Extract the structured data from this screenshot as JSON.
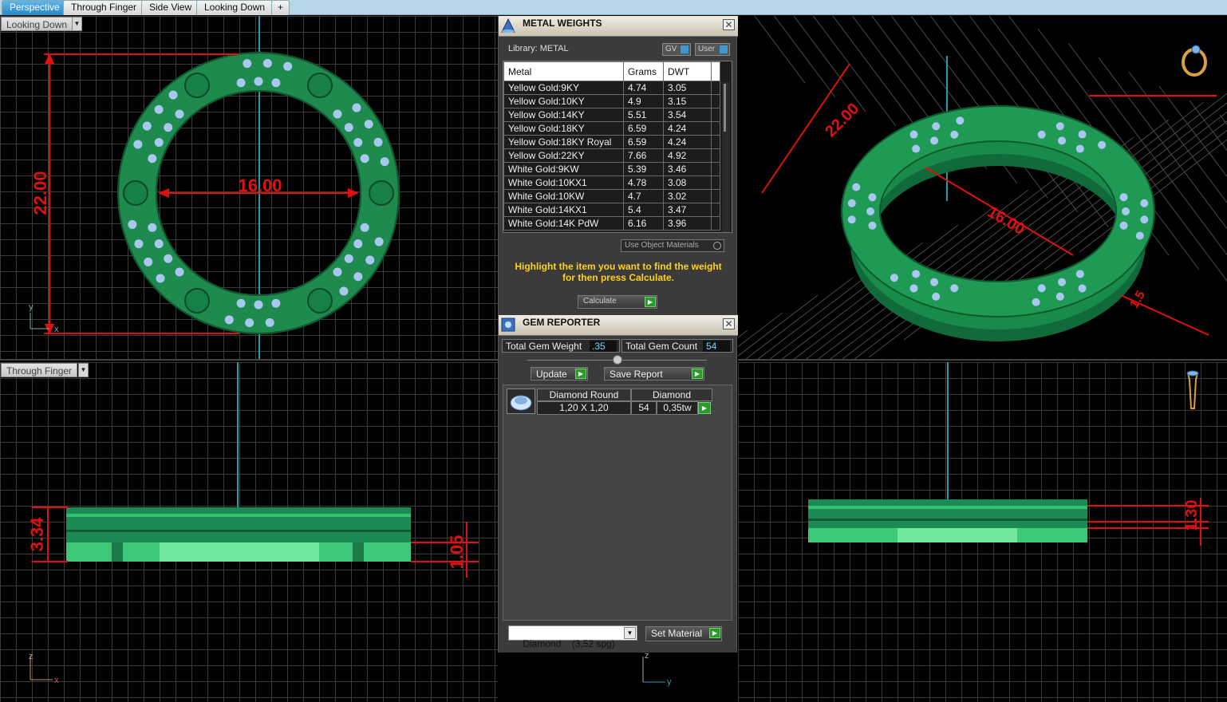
{
  "tabs": [
    {
      "label": "Perspective",
      "active": true
    },
    {
      "label": "Through Finger",
      "active": false
    },
    {
      "label": "Side View",
      "active": false
    },
    {
      "label": "Looking Down",
      "active": false
    }
  ],
  "add_tab_symbol": "+",
  "viewports": {
    "top_left": {
      "label": "Looking Down",
      "dim_width": "16.00",
      "dim_height": "22.00",
      "axis_v": "y",
      "axis_h": "x"
    },
    "top_right": {
      "dim_outer": "22.00",
      "dim_inner": "16.00",
      "dim_side": "1.5"
    },
    "bottom_left": {
      "label": "Through Finger",
      "dim_height": "3.34",
      "dim_small": "1.05",
      "axis_v": "z",
      "axis_h": "x"
    },
    "bottom_right": {
      "dim_height": "1.30",
      "axis_v": "z",
      "axis_h": "y"
    }
  },
  "metal_weights": {
    "title": "METAL WEIGHTS",
    "library_label": "Library: METAL",
    "gv_label": "GV",
    "user_label": "User",
    "columns": [
      "Metal",
      "Grams",
      "DWT"
    ],
    "rows": [
      {
        "metal": "Yellow Gold:9KY",
        "grams": "4.74",
        "dwt": "3.05"
      },
      {
        "metal": "Yellow Gold:10KY",
        "grams": "4.9",
        "dwt": "3.15"
      },
      {
        "metal": "Yellow Gold:14KY",
        "grams": "5.51",
        "dwt": "3.54"
      },
      {
        "metal": "Yellow Gold:18KY",
        "grams": "6.59",
        "dwt": "4.24"
      },
      {
        "metal": "Yellow Gold:18KY Royal",
        "grams": "6.59",
        "dwt": "4.24"
      },
      {
        "metal": "Yellow Gold:22KY",
        "grams": "7.66",
        "dwt": "4.92"
      },
      {
        "metal": "White Gold:9KW",
        "grams": "5.39",
        "dwt": "3.46"
      },
      {
        "metal": "White Gold:10KX1",
        "grams": "4.78",
        "dwt": "3.08"
      },
      {
        "metal": "White Gold:10KW",
        "grams": "4.7",
        "dwt": "3.02"
      },
      {
        "metal": "White Gold:14KX1",
        "grams": "5.4",
        "dwt": "3.47"
      },
      {
        "metal": "White Gold:14K PdW",
        "grams": "6.16",
        "dwt": "3.96"
      }
    ],
    "use_object_materials": "Use Object Materials",
    "instructions": "Highlight the item you want to find the weight for then press Calculate.",
    "calculate_label": "Calculate"
  },
  "gem_reporter": {
    "title": "GEM REPORTER",
    "total_weight_label": "Total Gem Weight",
    "total_weight_value": ".35",
    "total_count_label": "Total Gem Count",
    "total_count_value": "54",
    "update_label": "Update",
    "save_report_label": "Save Report",
    "gem": {
      "shape": "Diamond Round",
      "material": "Diamond",
      "size": "1,20 X 1,20",
      "count": "54",
      "weight": "0,35tw"
    },
    "material_select": "Diamond    (3,52 spg)",
    "set_material_label": "Set Material"
  },
  "colors": {
    "ring_green": "#1e8a4e",
    "dimension_red": "#e01010",
    "instruction_yellow": "#ffd21a"
  }
}
